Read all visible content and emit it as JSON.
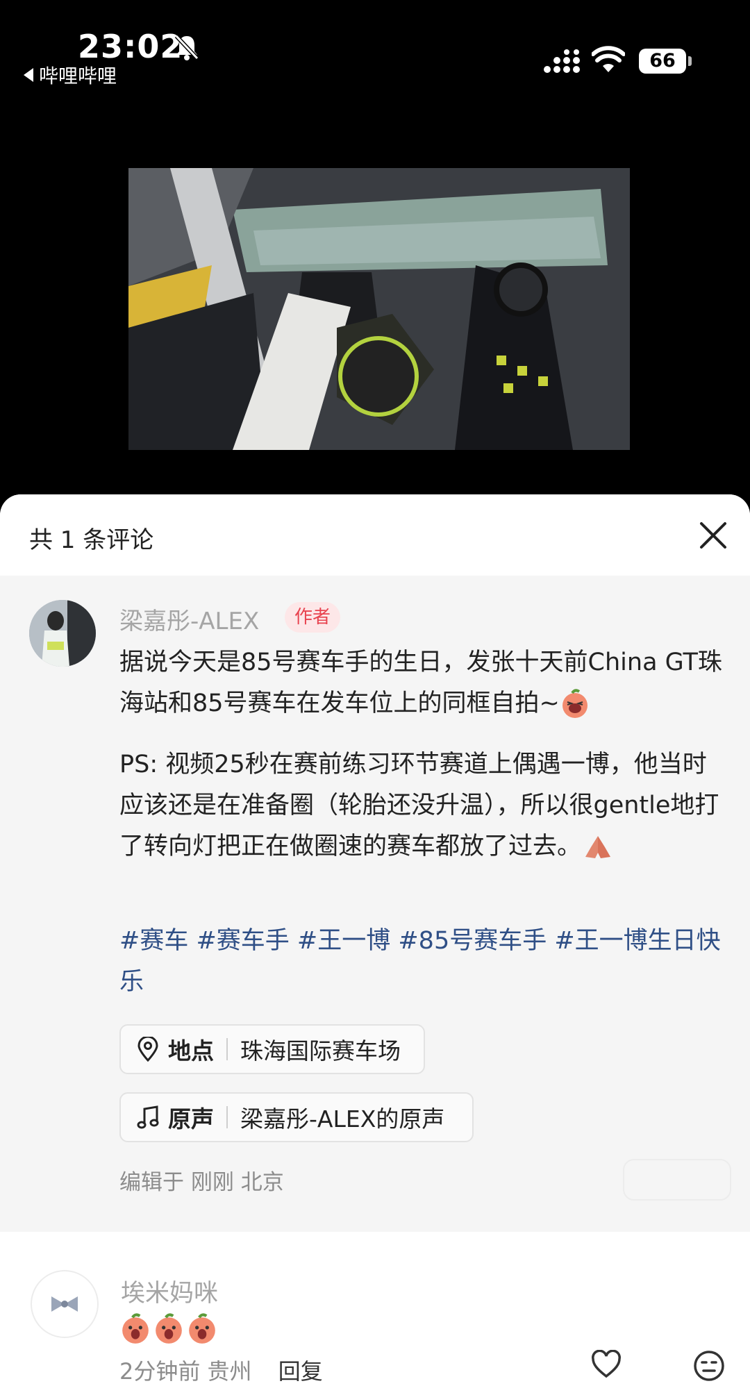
{
  "status_bar": {
    "time": "23:02",
    "back_app": "哔哩哔哩",
    "battery": "66",
    "icons": [
      "bell-off-icon",
      "signal-icon",
      "wifi-icon",
      "battery-icon"
    ]
  },
  "video": {
    "description_icon": "video-thumbnail"
  },
  "sheet": {
    "title": "共 1 条评论",
    "close_icon": "close-icon"
  },
  "author_comment": {
    "username": "梁嘉彤-ALEX",
    "badge": "作者",
    "paragraph1": "据说今天是85号赛车手的生日，发张十天前China GT珠海站和85号赛车在发车位上的同框自拍~",
    "paragraph2": "PS: 视频25秒在赛前练习环节赛道上偶遇一博，他当时应该还是在准备圈（轮胎还没升温），所以很gentle地打了转向灯把正在做圈速的赛车都放了过去。",
    "hashtags": "#赛车 #赛车手 #王一博 #85号赛车手 #王一博生日快乐",
    "location": {
      "label": "地点",
      "value": "珠海国际赛车场",
      "icon": "location-pin-icon"
    },
    "sound": {
      "label": "原声",
      "value": "梁嘉彤-ALEX的原声",
      "icon": "music-note-icon"
    },
    "edited": "编辑于  刚刚  北京"
  },
  "reply_comment": {
    "username": "埃米妈咪",
    "meta_time": "2分钟前  贵州",
    "reply_label": "回复",
    "icons": [
      "heart-icon",
      "emoji-face-icon"
    ]
  },
  "colors": {
    "accent_red": "#e8434f",
    "hashtag_blue": "#2f4f86",
    "sheet_bg": "#f5f5f5"
  }
}
